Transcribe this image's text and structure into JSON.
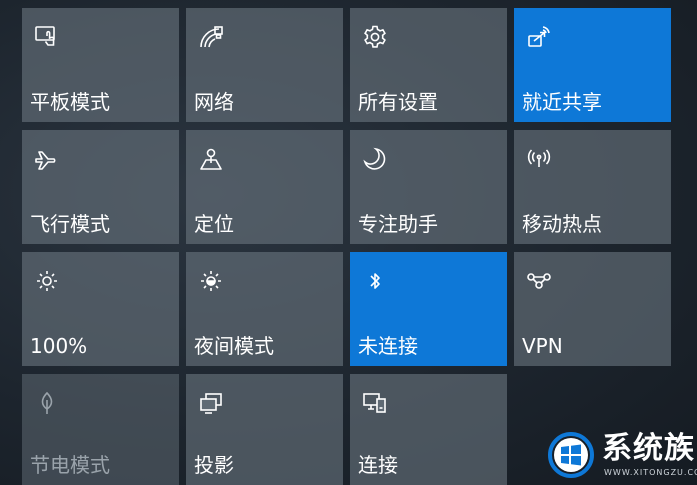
{
  "tiles": [
    {
      "label": "平板模式",
      "icon": "tablet-mode-icon",
      "state": "normal"
    },
    {
      "label": "网络",
      "icon": "network-icon",
      "state": "normal"
    },
    {
      "label": "所有设置",
      "icon": "gear-icon",
      "state": "normal"
    },
    {
      "label": "就近共享",
      "icon": "nearby-share-icon",
      "state": "active"
    },
    {
      "label": "飞行模式",
      "icon": "airplane-icon",
      "state": "normal"
    },
    {
      "label": "定位",
      "icon": "location-icon",
      "state": "normal"
    },
    {
      "label": "专注助手",
      "icon": "moon-icon",
      "state": "normal"
    },
    {
      "label": "移动热点",
      "icon": "hotspot-icon",
      "state": "normal"
    },
    {
      "label": "100%",
      "icon": "brightness-icon",
      "state": "normal"
    },
    {
      "label": "夜间模式",
      "icon": "night-light-icon",
      "state": "normal"
    },
    {
      "label": "未连接",
      "icon": "bluetooth-icon",
      "state": "active"
    },
    {
      "label": "VPN",
      "icon": "vpn-icon",
      "state": "normal"
    },
    {
      "label": "节电模式",
      "icon": "battery-saver-icon",
      "state": "disabled"
    },
    {
      "label": "投影",
      "icon": "project-icon",
      "state": "normal"
    },
    {
      "label": "连接",
      "icon": "connect-icon",
      "state": "normal"
    }
  ],
  "colors": {
    "active": "#0e78d7",
    "tile": "#5f6a74",
    "disabled_text": "#9aa3ab"
  },
  "watermark": {
    "text": "系统族",
    "sub": "WWW.XITONGZU.COM"
  }
}
